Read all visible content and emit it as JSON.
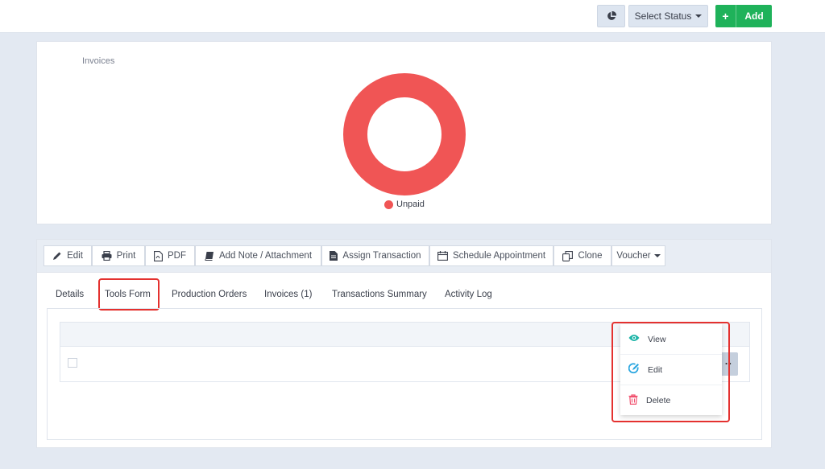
{
  "topbar": {
    "chart_icon": "pie-chart-icon",
    "select_status_label": "Select Status",
    "add_label": "Add",
    "add_color": "#1fb25a"
  },
  "chart": {
    "title": "Invoices",
    "legend_label": "Unpaid",
    "color": "#f05555"
  },
  "chart_data": {
    "type": "pie",
    "title": "Invoices",
    "categories": [
      "Unpaid"
    ],
    "values": [
      100
    ],
    "colors": [
      "#f05555"
    ],
    "donut": true,
    "legend": "bottom"
  },
  "toolbar": {
    "buttons": [
      {
        "label": "Edit",
        "icon": "pencil-icon"
      },
      {
        "label": "Print",
        "icon": "printer-icon"
      },
      {
        "label": "PDF",
        "icon": "pdf-file-icon"
      },
      {
        "label": "Add Note / Attachment",
        "icon": "book-icon"
      },
      {
        "label": "Assign Transaction",
        "icon": "document-icon"
      },
      {
        "label": "Schedule Appointment",
        "icon": "calendar-icon"
      },
      {
        "label": "Clone",
        "icon": "clone-icon"
      },
      {
        "label": "Voucher",
        "icon": "caret-down-icon"
      }
    ]
  },
  "tabs": [
    {
      "label": "Details"
    },
    {
      "label": "Tools Form"
    },
    {
      "label": "Production Orders"
    },
    {
      "label": "Invoices (1)"
    },
    {
      "label": "Transactions Summary"
    },
    {
      "label": "Activity Log"
    }
  ],
  "table": {
    "more_label": ".."
  },
  "menu": {
    "items": [
      {
        "label": "View",
        "icon": "eye-icon",
        "color": "#1fb5a8"
      },
      {
        "label": "Edit",
        "icon": "edit-icon",
        "color": "#2aa6e0"
      },
      {
        "label": "Delete",
        "icon": "trash-icon",
        "color": "#f0506e"
      }
    ]
  }
}
